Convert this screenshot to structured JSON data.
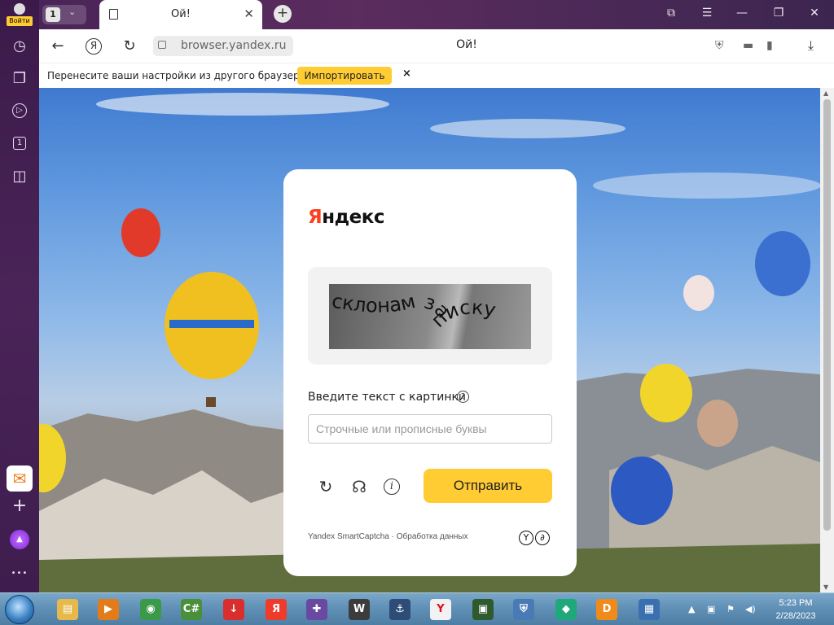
{
  "sidebar": {
    "login_label": "Войти",
    "items": [
      {
        "name": "history-icon",
        "glyph": "◷"
      },
      {
        "name": "collections-icon",
        "glyph": "❐"
      },
      {
        "name": "video-icon",
        "glyph": "▷"
      },
      {
        "name": "tab-one-icon",
        "glyph": "1"
      },
      {
        "name": "screenshot-icon",
        "glyph": "◫"
      }
    ],
    "bottom_items": [
      {
        "name": "mail-icon",
        "glyph": "✉"
      },
      {
        "name": "add-panel-icon",
        "glyph": "+"
      },
      {
        "name": "alice-icon",
        "glyph": "▲"
      },
      {
        "name": "more-icon",
        "glyph": "•••"
      }
    ]
  },
  "tabbar": {
    "tab_count": "1",
    "active_tab_title": "Ой!",
    "new_tab_symbol": "+"
  },
  "addressbar": {
    "url": "browser.yandex.ru",
    "page_title": "Ой!"
  },
  "infobar": {
    "message": "Перенесите ваши настройки из другого браузера.",
    "import_label": "Импортировать",
    "close_symbol": "×"
  },
  "captcha": {
    "brand_first": "Я",
    "brand_rest": "ндекс",
    "captcha_text": "склонам записку",
    "prompt": "Введите текст с картинки",
    "help_symbol": "?",
    "input_placeholder": "Строчные или прописные буквы",
    "submit_label": "Отправить",
    "footer_brand": "Yandex SmartCaptcha",
    "footer_separator": " · ",
    "footer_link": "Обработка данных"
  },
  "taskbar": {
    "apps": [
      {
        "name": "explorer",
        "color": "#e6b94a",
        "glyph": "▤"
      },
      {
        "name": "media-player",
        "color": "#e27b1a",
        "glyph": "▶"
      },
      {
        "name": "chrome",
        "color": "#3a9a4a",
        "glyph": "◉"
      },
      {
        "name": "csharp-editor",
        "color": "#4a8f3a",
        "glyph": "C#"
      },
      {
        "name": "downloader",
        "color": "#d92e2e",
        "glyph": "↓"
      },
      {
        "name": "yandex",
        "color": "#ee3b2b",
        "glyph": "Я"
      },
      {
        "name": "game-controller",
        "color": "#6a4aa0",
        "glyph": "✚"
      },
      {
        "name": "world-of-tanks",
        "color": "#3c3c3c",
        "glyph": "W"
      },
      {
        "name": "world-of-warships",
        "color": "#2e4c78",
        "glyph": "⚓"
      },
      {
        "name": "yandex-browser",
        "color": "#f2f2f2",
        "glyph": "Y"
      },
      {
        "name": "monitor-app",
        "color": "#2e5a2e",
        "glyph": "▣"
      },
      {
        "name": "network-app",
        "color": "#4a7ab5",
        "glyph": "⛨"
      },
      {
        "name": "cube-app",
        "color": "#1fa87a",
        "glyph": "◆"
      },
      {
        "name": "d3-app",
        "color": "#f08a1a",
        "glyph": "D"
      },
      {
        "name": "folder-app",
        "color": "#3a6fb0",
        "glyph": "▦"
      }
    ],
    "time": "5:23 PM",
    "date": "2/28/2023"
  }
}
